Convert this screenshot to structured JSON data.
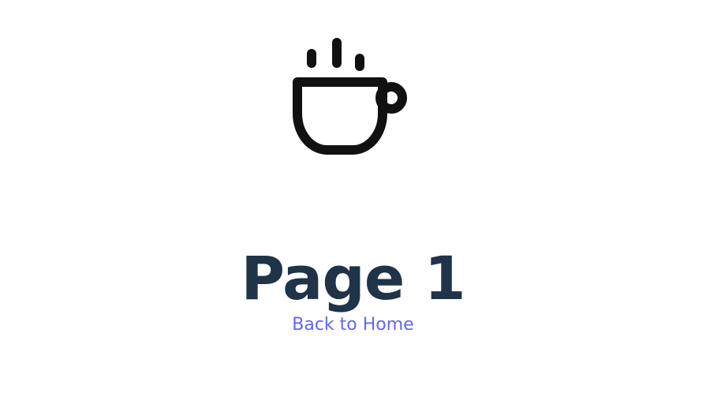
{
  "page": {
    "icon": "coffee-cup-icon",
    "title": "Page 1",
    "back_link_label": "Back to Home"
  },
  "colors": {
    "icon": "#111111",
    "title": "#1f3349",
    "link": "#6366f1",
    "background": "#ffffff"
  }
}
